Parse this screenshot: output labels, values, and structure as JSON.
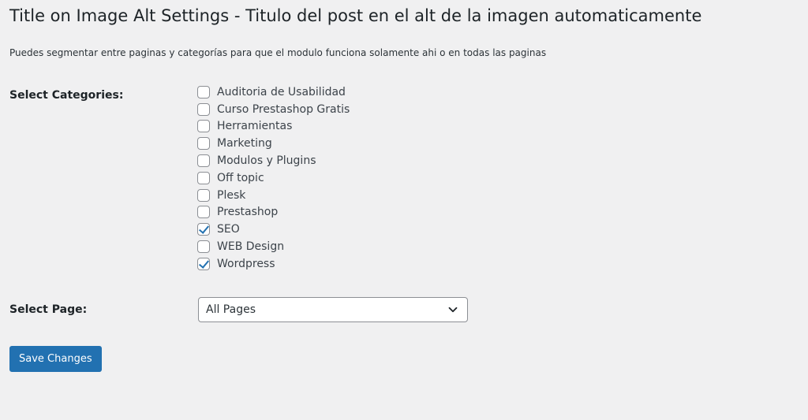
{
  "page": {
    "title": "Title on Image Alt Settings - Titulo del post en el alt de la imagen automaticamente",
    "description": "Puedes segmentar entre paginas y categorías para que el modulo funciona solamente ahi o en todas las paginas"
  },
  "categories": {
    "label": "Select Categories:",
    "items": [
      {
        "label": "Auditoria de Usabilidad",
        "checked": false
      },
      {
        "label": "Curso Prestashop Gratis",
        "checked": false
      },
      {
        "label": "Herramientas",
        "checked": false
      },
      {
        "label": "Marketing",
        "checked": false
      },
      {
        "label": "Modulos y Plugins",
        "checked": false
      },
      {
        "label": "Off topic",
        "checked": false
      },
      {
        "label": "Plesk",
        "checked": false
      },
      {
        "label": "Prestashop",
        "checked": false
      },
      {
        "label": "SEO",
        "checked": true
      },
      {
        "label": "WEB Design",
        "checked": false
      },
      {
        "label": "Wordpress",
        "checked": true
      }
    ]
  },
  "page_select": {
    "label": "Select Page:",
    "selected": "All Pages",
    "icon": "chevron-down-icon"
  },
  "actions": {
    "save_label": "Save Changes"
  },
  "colors": {
    "background": "#f0f0f1",
    "accent": "#2271b1",
    "text": "#1d2327"
  }
}
